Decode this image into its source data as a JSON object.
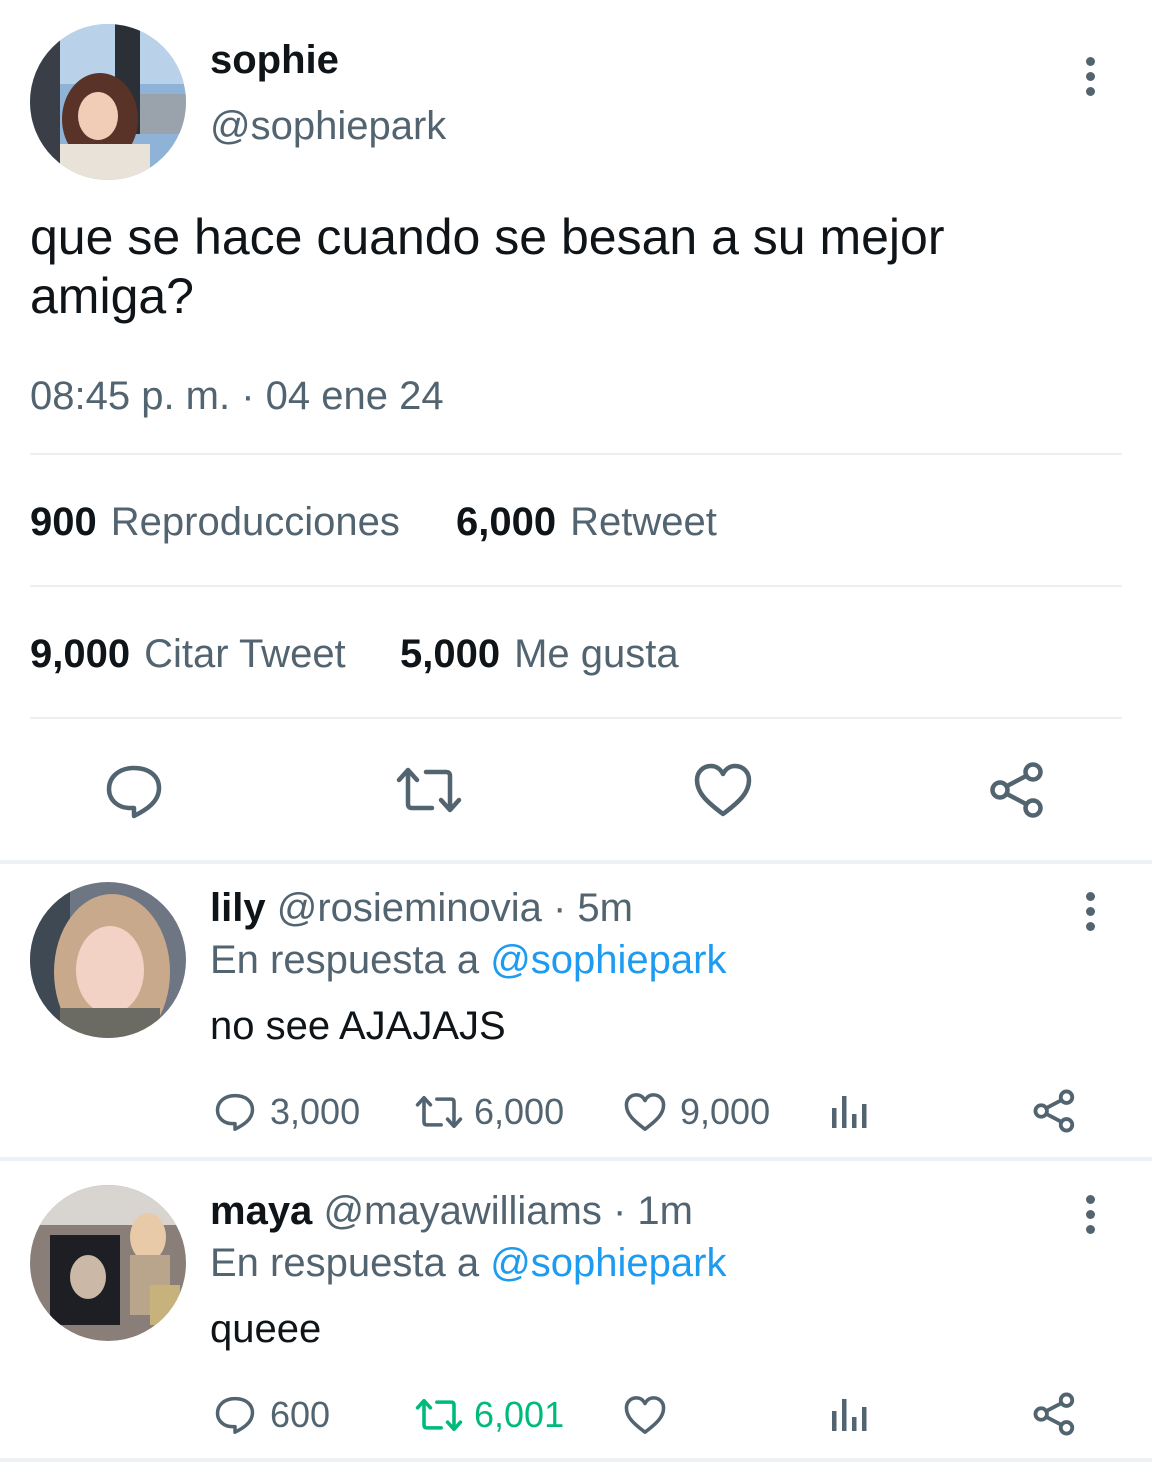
{
  "main_tweet": {
    "display_name": "sophie",
    "handle": "@sophiepark",
    "text": "que se hace cuando se besan a su mejor amiga?",
    "timestamp": "08:45 p. m. · 04 ene 24",
    "stats": {
      "views_count": "900",
      "views_label": "Reproducciones",
      "retweets_count": "6,000",
      "retweets_label": "Retweet",
      "quotes_count": "9,000",
      "quotes_label": "Citar Tweet",
      "likes_count": "5,000",
      "likes_label": "Me gusta"
    },
    "actions": [
      "reply-icon",
      "retweet-icon",
      "like-icon",
      "share-icon"
    ]
  },
  "replies": [
    {
      "display_name": "lily",
      "handle": "@rosieminovia",
      "time": "· 5m",
      "reply_prefix": "En respuesta a",
      "reply_to": "@sophiepark",
      "text": "no see AJAJAJS",
      "reply_count": "3,000",
      "retweet_count": "6,000",
      "like_count": "9,000"
    },
    {
      "display_name": "maya",
      "handle": "@mayawilliams",
      "time": "· 1m",
      "reply_prefix": "En respuesta a",
      "reply_to": "@sophiepark",
      "text": "queee",
      "reply_count": "600",
      "retweet_count": "6,001",
      "like_count": ""
    }
  ],
  "colors": {
    "text": "#0f1419",
    "secondary": "#536471",
    "link": "#1d9bf0",
    "retweet_active": "#00ba7c"
  }
}
